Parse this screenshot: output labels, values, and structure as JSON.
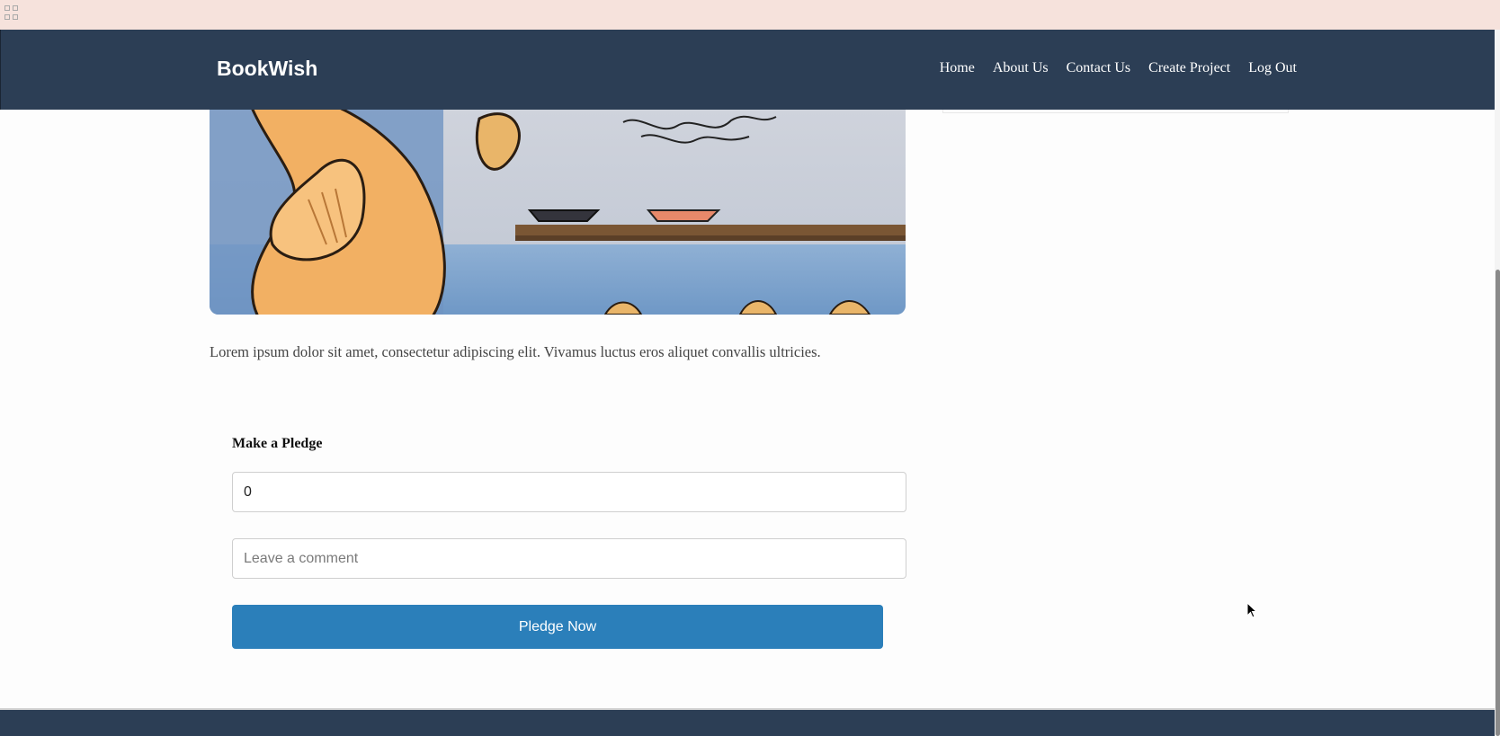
{
  "toolbar": {
    "icon": "apps-grid-icon"
  },
  "navbar": {
    "brand": "BookWish",
    "links": [
      "Home",
      "About Us",
      "Contact Us",
      "Create Project",
      "Log Out"
    ]
  },
  "project": {
    "description": "Lorem ipsum dolor sit amet, consectetur adipiscing elit. Vivamus luctus eros aliquet convallis ultricies."
  },
  "pledge": {
    "title": "Make a Pledge",
    "amount_value": "0",
    "comment_placeholder": "Leave a comment",
    "button_label": "Pledge Now"
  },
  "colors": {
    "navbar": "#2c3e55",
    "button": "#2b7fba",
    "top_strip": "#f6e2dc"
  }
}
